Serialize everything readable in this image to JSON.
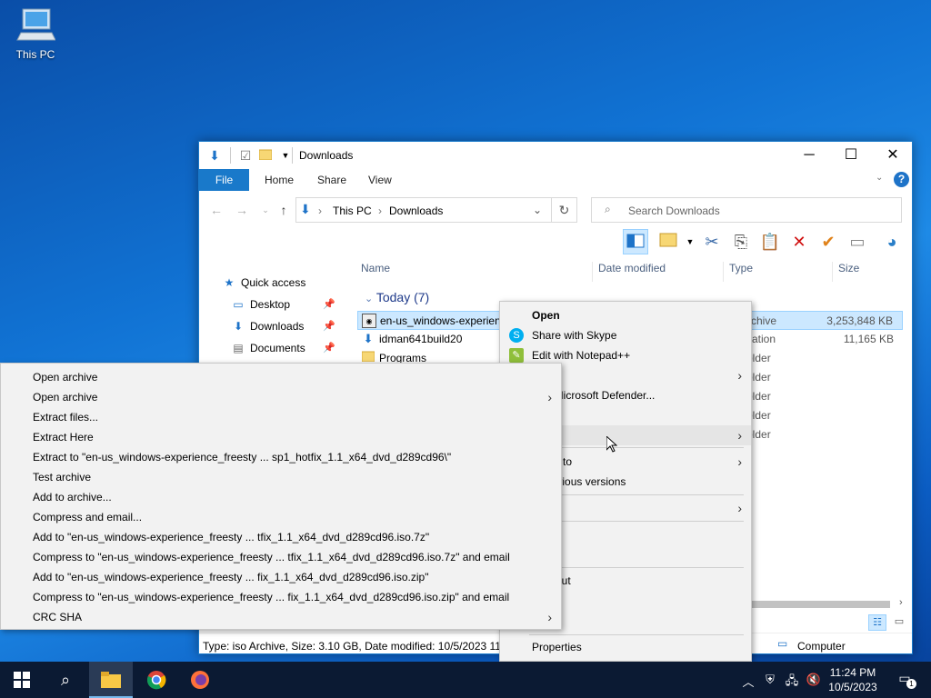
{
  "desktop": {
    "icon_label": "This PC"
  },
  "window": {
    "title": "Downloads",
    "ribbon_tabs": [
      "File",
      "Home",
      "Share",
      "View"
    ],
    "address": {
      "root": "This PC",
      "current": "Downloads"
    },
    "search_placeholder": "Search Downloads",
    "nav_pane": {
      "quick_access": "Quick access",
      "items": [
        "Desktop",
        "Downloads",
        "Documents"
      ]
    },
    "columns": {
      "name": "Name",
      "date": "Date modified",
      "type": "Type",
      "size": "Size"
    },
    "group_label": "Today (7)",
    "files": [
      {
        "name": "en-us_windows-experien",
        "type": "rchive",
        "size": "3,253,848 KB"
      },
      {
        "name": "idman641build20",
        "type": "cation",
        "size": "11,165 KB"
      },
      {
        "name": "Programs",
        "type": "older",
        "size": ""
      },
      {
        "name": "",
        "type": "older",
        "size": ""
      },
      {
        "name": "",
        "type": "older",
        "size": ""
      },
      {
        "name": "",
        "type": "older",
        "size": ""
      },
      {
        "name": "",
        "type": "older",
        "size": ""
      }
    ],
    "status_text": "Type: iso Archive, Size: 3.10 GB, Date modified: 10/5/2023 11:24",
    "status_right": "Computer"
  },
  "context_menu": {
    "items": [
      {
        "label": "Open",
        "bold": true
      },
      {
        "label": "Share with Skype"
      },
      {
        "label": "Edit with Notepad++"
      },
      {
        "label": "",
        "submenu": true
      },
      {
        "label": "with Microsoft Defender..."
      },
      {
        "label": ""
      },
      {
        "label": "with",
        "submenu": true
      },
      {
        "label": "ccess to",
        "submenu": true
      },
      {
        "label": "e previous versions"
      },
      {
        "label": "o",
        "submenu": true
      },
      {
        "label": ""
      },
      {
        "label": ""
      },
      {
        "label": "shortcut"
      },
      {
        "label": ""
      },
      {
        "label": "e"
      },
      {
        "label": "Properties"
      }
    ]
  },
  "submenu": {
    "items": [
      {
        "label": "Open archive"
      },
      {
        "label": "Open archive",
        "submenu": true
      },
      {
        "label": "Extract files..."
      },
      {
        "label": "Extract Here"
      },
      {
        "label": "Extract to \"en-us_windows-experience_freesty ... sp1_hotfix_1.1_x64_dvd_d289cd96\\\""
      },
      {
        "label": "Test archive"
      },
      {
        "label": "Add to archive..."
      },
      {
        "label": "Compress and email..."
      },
      {
        "label": "Add to \"en-us_windows-experience_freesty ... tfix_1.1_x64_dvd_d289cd96.iso.7z\""
      },
      {
        "label": "Compress to \"en-us_windows-experience_freesty ... tfix_1.1_x64_dvd_d289cd96.iso.7z\" and email"
      },
      {
        "label": "Add to \"en-us_windows-experience_freesty ... fix_1.1_x64_dvd_d289cd96.iso.zip\""
      },
      {
        "label": "Compress to \"en-us_windows-experience_freesty ... fix_1.1_x64_dvd_d289cd96.iso.zip\" and email"
      },
      {
        "label": "CRC SHA",
        "submenu": true
      }
    ]
  },
  "taskbar": {
    "clock_time": "11:24 PM",
    "clock_date": "10/5/2023",
    "notification_count": "1"
  },
  "colors": {
    "accent": "#1979ca",
    "taskbar": "#0b1a33",
    "selection": "#cce8ff"
  }
}
